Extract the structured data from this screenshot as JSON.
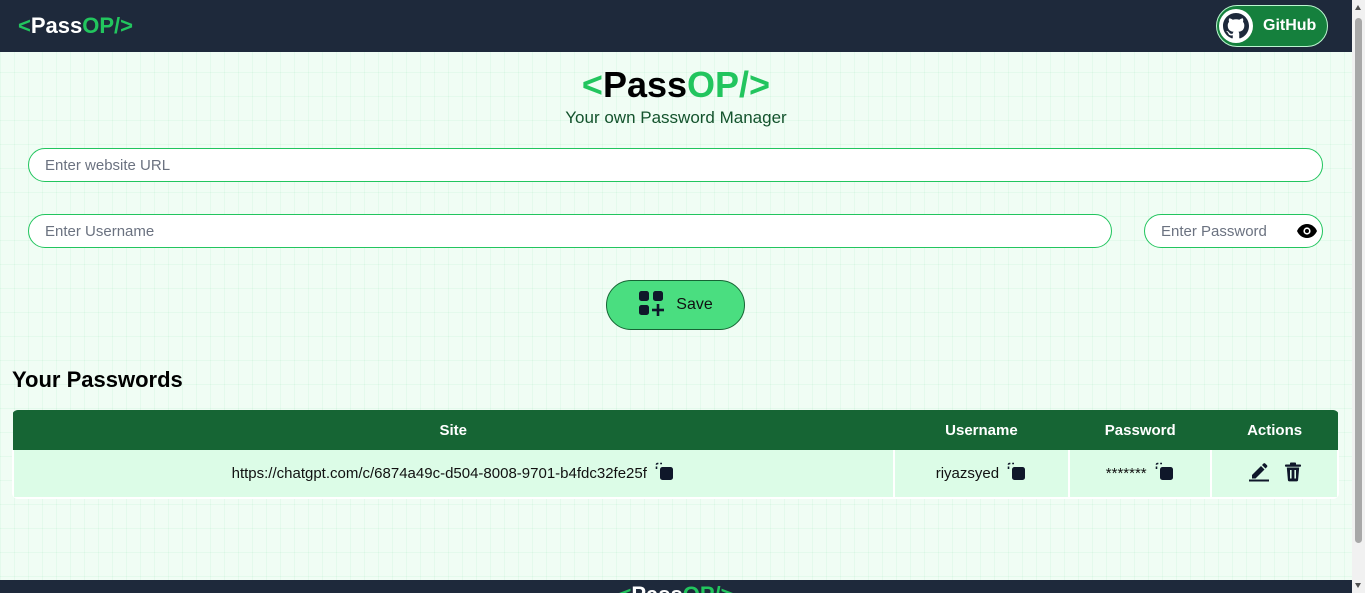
{
  "nav": {
    "logo_open": "<",
    "logo_pass": "Pass",
    "logo_op": "OP/>",
    "github_label": "GitHub"
  },
  "hero": {
    "logo_open": "<",
    "logo_pass": "Pass",
    "logo_op": "OP/>",
    "subtitle": "Your own Password Manager"
  },
  "form": {
    "url_placeholder": "Enter website URL",
    "username_placeholder": "Enter Username",
    "password_placeholder": "Enter Password",
    "save_label": "Save"
  },
  "passwords": {
    "title": "Your Passwords",
    "columns": [
      "Site",
      "Username",
      "Password",
      "Actions"
    ],
    "rows": [
      {
        "site": "https://chatgpt.com/c/6874a49c-d504-8008-9701-b4fdc32fe25f",
        "username": "riyazsyed",
        "password": "*******"
      }
    ]
  },
  "footer": {
    "logo_open": "<",
    "logo_pass": "Pass",
    "logo_op": "OP/>"
  },
  "colors": {
    "navbar": "#1e293b",
    "accent_green": "#22c55e",
    "button_green": "#4ade80",
    "table_header": "#166534",
    "table_row": "#dcfce7"
  },
  "icons": [
    "github-icon",
    "eye-icon",
    "add-grid-icon",
    "copy-icon",
    "edit-icon",
    "delete-icon"
  ]
}
